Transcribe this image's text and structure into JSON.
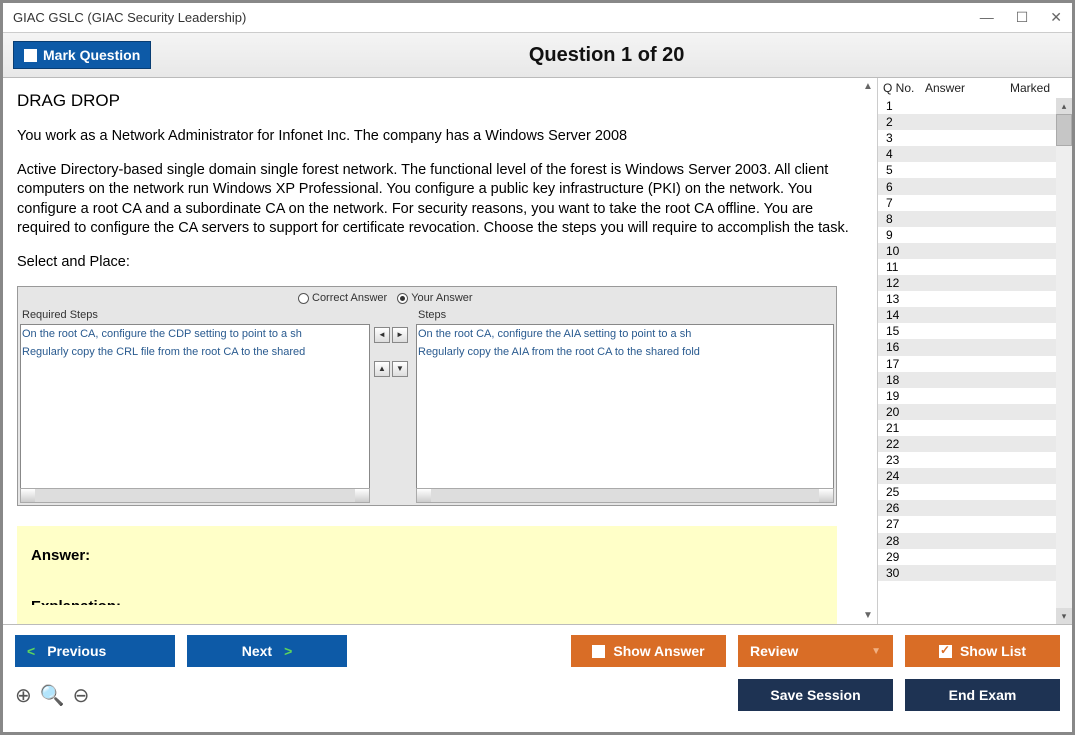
{
  "titlebar": {
    "text": "GIAC GSLC (GIAC Security Leadership)"
  },
  "win": {
    "min": "—",
    "max": "☐",
    "close": "✕"
  },
  "mark_btn": "Mark Question",
  "question_header": "Question 1 of 20",
  "q": {
    "type": "DRAG DROP",
    "intro": "You work as a Network Administrator for Infonet Inc. The company has a Windows Server 2008",
    "body": "Active Directory-based single domain single forest network. The functional level of the forest is Windows Server 2003. All client computers on the network run Windows XP Professional. You configure a public key infrastructure (PKI) on the network. You configure a root CA and a subordinate CA on the network. For security reasons, you want to take the root CA offline. You are required to configure the CA servers to support for certificate revocation. Choose the steps you will require to accomplish the task.",
    "select": "Select and Place:"
  },
  "drag": {
    "radio1": "Correct Answer",
    "radio2": "Your Answer",
    "left_title": "Required Steps",
    "right_title": "Steps",
    "left_items": [
      "On the root CA, configure the CDP setting to point to a sh",
      "Regularly copy the CRL file from the root CA to the shared"
    ],
    "right_items": [
      "On the root CA, configure the AIA setting to point to a sh",
      "",
      "Regularly copy the AIA from the root CA to the shared fold"
    ]
  },
  "answer": {
    "label": "Answer:",
    "expl": "Explanation:"
  },
  "side": {
    "h1": "Q No.",
    "h2": "Answer",
    "h3": "Marked",
    "rows": [
      1,
      2,
      3,
      4,
      5,
      6,
      7,
      8,
      9,
      10,
      11,
      12,
      13,
      14,
      15,
      16,
      17,
      18,
      19,
      20,
      21,
      22,
      23,
      24,
      25,
      26,
      27,
      28,
      29,
      30
    ]
  },
  "buttons": {
    "prev": "Previous",
    "next": "Next",
    "show": "Show Answer",
    "review": "Review",
    "showlist": "Show List",
    "save": "Save Session",
    "end": "End Exam"
  }
}
